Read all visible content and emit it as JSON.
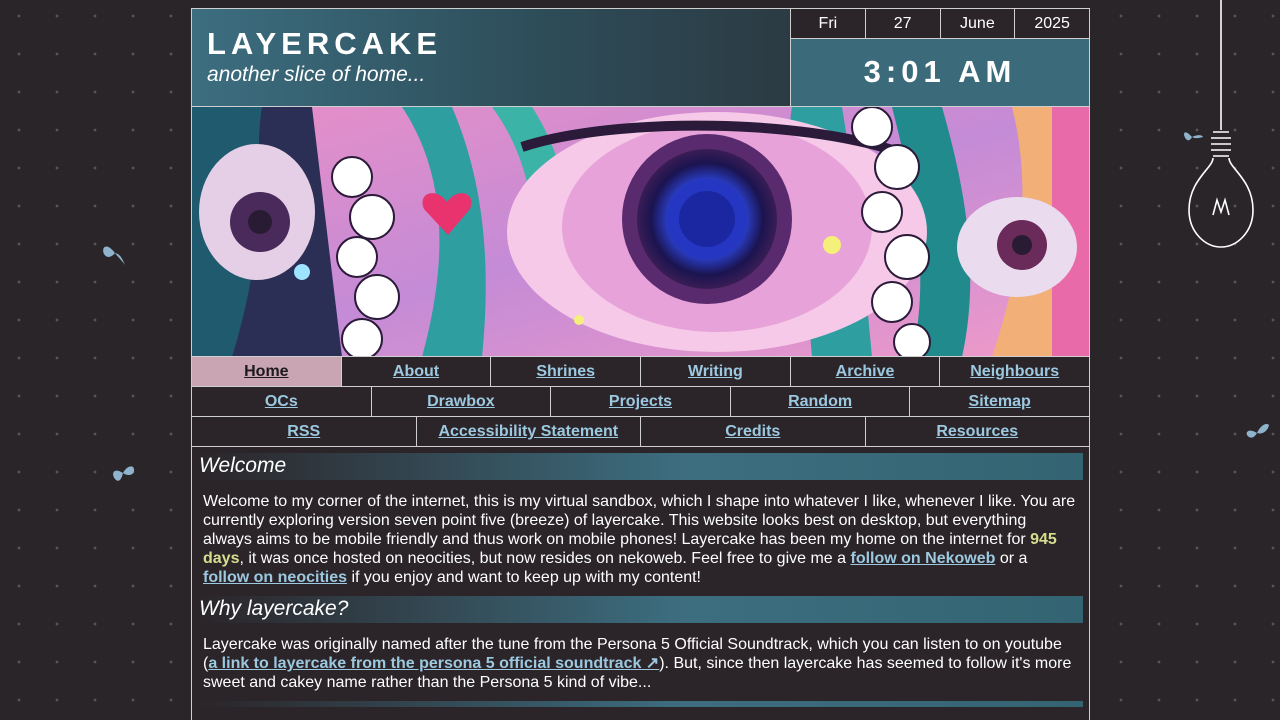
{
  "site": {
    "title": "LAYERCAKE",
    "tagline": "another slice of home..."
  },
  "date": {
    "weekday": "Fri",
    "day": "27",
    "month": "June",
    "year": "2025"
  },
  "clock": "3:01 AM",
  "banner": {
    "description_icon": "anime-eye-banner-image"
  },
  "nav": {
    "row1": [
      "Home",
      "About",
      "Shrines",
      "Writing",
      "Archive",
      "Neighbours"
    ],
    "row2": [
      "OCs",
      "Drawbox",
      "Projects",
      "Random",
      "Sitemap"
    ],
    "row3": [
      "RSS",
      "Accessibility Statement",
      "Credits",
      "Resources"
    ],
    "active": "Home"
  },
  "welcome": {
    "heading": "Welcome",
    "text1": "Welcome to my corner of the internet, this is my virtual sandbox, which I shape into whatever I like, whenever I like. You are currently exploring version seven point five (breeze) of layercake. This website looks best on desktop, but everything always aims to be mobile friendly and thus work on mobile phones! Layercake has been my home on the internet for ",
    "days": "945 days",
    "text2": ", it was once hosted on neocities, but now resides on nekoweb. Feel free to give me a ",
    "link1": "follow on Nekoweb",
    "text3": " or a ",
    "link2": "follow on neocities",
    "text4": " if you enjoy and want to keep up with my content!"
  },
  "why": {
    "heading": "Why layercake?",
    "text1": "Layercake was originally named after the tune from the Persona 5 Official Soundtrack, which you can listen to on youtube (",
    "link": "a link to layercake from the persona 5 official soundtrack ↗",
    "text2": "). But, since then layercake has seemed to follow it's more sweet and cakey name rather than the Persona 5 kind of vibe..."
  },
  "colors": {
    "background": "#2a2529",
    "accent": "#3c6e80",
    "link": "#9cc8e0",
    "highlight": "#d6de8e",
    "active_tab": "#c9a5b3"
  }
}
